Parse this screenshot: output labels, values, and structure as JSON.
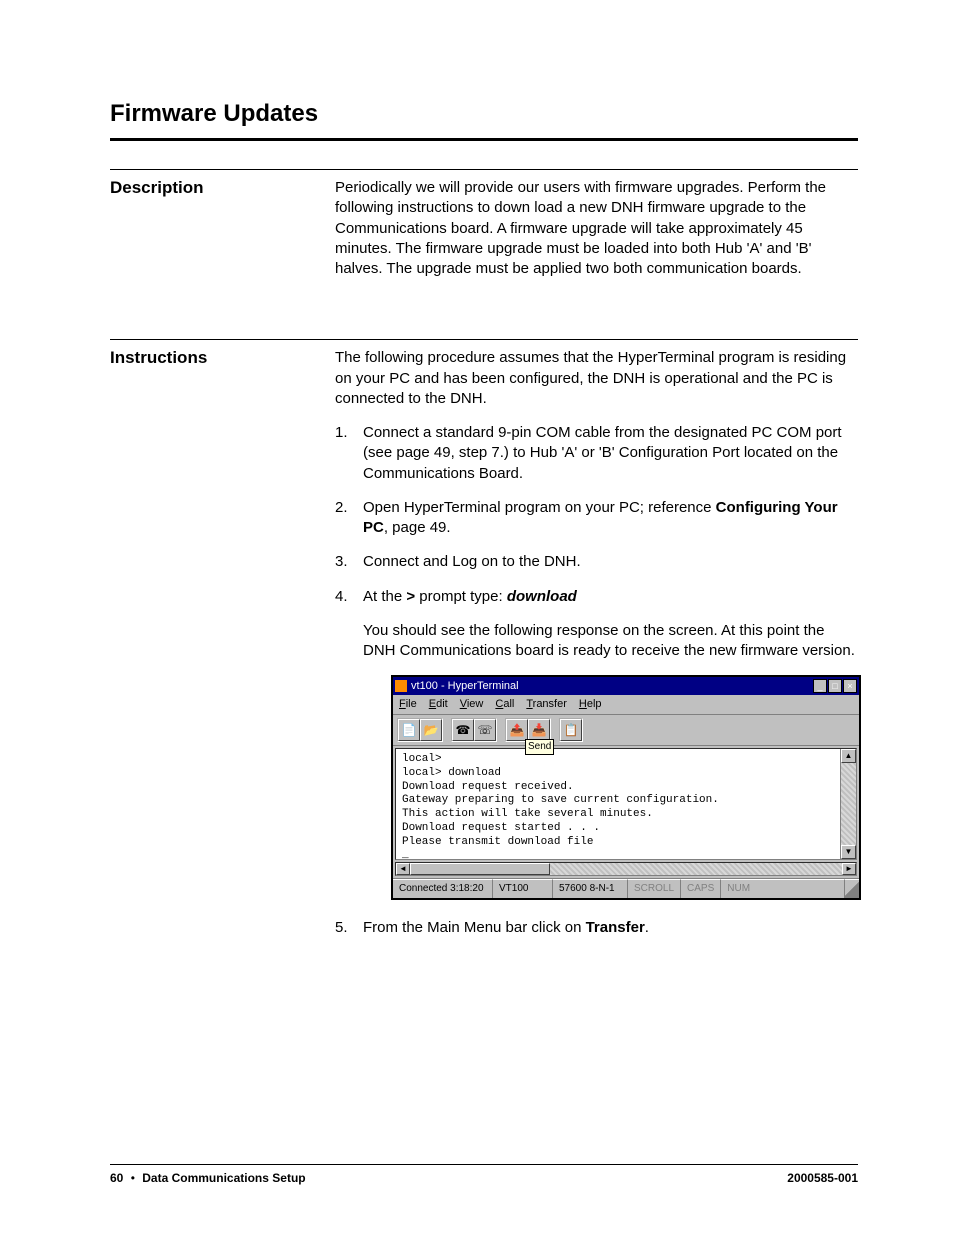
{
  "page": {
    "title": "Firmware Updates"
  },
  "description": {
    "label": "Description",
    "body": "Periodically we will provide our users with firmware upgrades. Perform the following instructions to down load a new DNH firmware upgrade to the Communications board. A firmware upgrade will take approximately 45 minutes. The firmware upgrade must be loaded into both Hub 'A' and 'B' halves. The upgrade must be applied two both communication boards."
  },
  "instructions": {
    "label": "Instructions",
    "intro": "The following procedure assumes that the HyperTerminal program is residing on your PC and has been configured, the DNH is operational and the PC is connected to the DNH.",
    "steps": {
      "s1": "Connect a standard 9-pin COM cable from the designated PC COM port (see page 49, step 7.) to Hub 'A' or 'B' Configuration Port located on the Communications Board.",
      "s2_a": "Open HyperTerminal program on your PC; reference ",
      "s2_bold": "Configuring Your PC",
      "s2_b": ", page 49.",
      "s3": "Connect and Log on to the DNH.",
      "s4_a": "At the ",
      "s4_b": " prompt type: ",
      "s4_prompt": ">",
      "s4_cmd": "download",
      "s4_follow": "You should see the following response on the screen. At this point the DNH Communications board is ready to receive the new firmware version.",
      "s5_a": "From the Main Menu bar click on ",
      "s5_bold": "Transfer",
      "s5_b": "."
    }
  },
  "hyperterminal": {
    "title": "vt100 - HyperTerminal",
    "menu": {
      "file": "File",
      "edit": "Edit",
      "view": "View",
      "call": "Call",
      "transfer": "Transfer",
      "help": "Help"
    },
    "send_tooltip": "Send",
    "terminal_text": "local>\nlocal> download\nDownload request received.\nGateway preparing to save current configuration.\nThis action will take several minutes.\nDownload request started . . .\nPlease transmit download file\n_",
    "status": {
      "connected": "Connected 3:18:20",
      "emulation": "VT100",
      "settings": "57600 8-N-1",
      "scroll": "SCROLL",
      "caps": "CAPS",
      "num": "NUM"
    }
  },
  "footer": {
    "page_num": "60",
    "section": "Data Communications Setup",
    "docnum": "2000585-001"
  }
}
